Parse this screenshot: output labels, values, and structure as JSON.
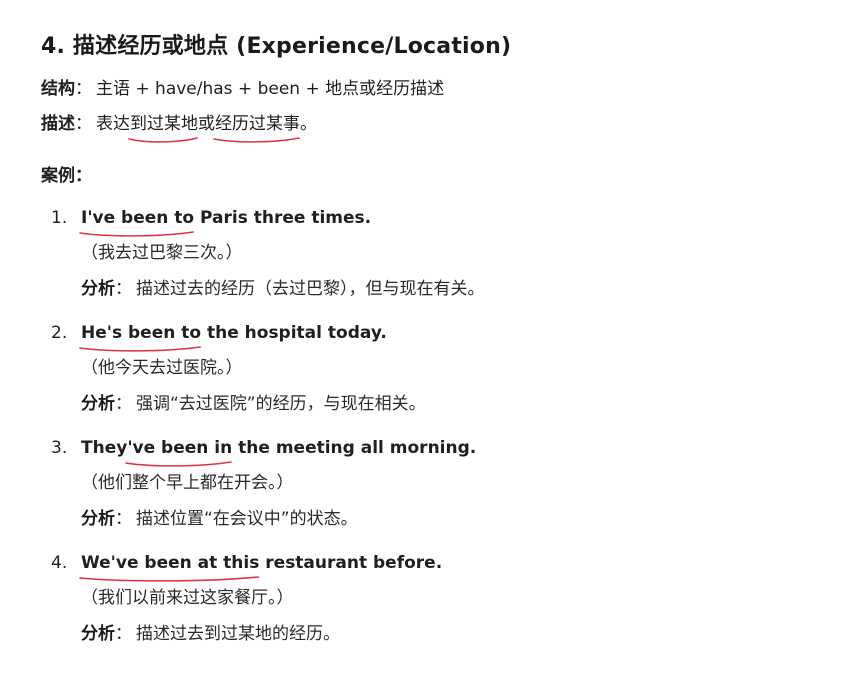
{
  "heading": "4. 描述经历或地点 (Experience/Location)",
  "structure": {
    "label": "结构",
    "colon": "：",
    "text": "主语 + have/has + been + 地点或经历描述"
  },
  "description": {
    "label": "描述",
    "colon": "：",
    "prefix": "表达",
    "part1": "到过某地",
    "middle": "或",
    "part2": "经历过某事",
    "suffix": "。"
  },
  "examples_label": "案例：",
  "analysis_label": "分析",
  "analysis_colon": "：",
  "underline_color": "#d9363e",
  "examples": [
    {
      "num": "1.",
      "en_highlight": "I've been to",
      "en_rest": " Paris three times.",
      "zh": "（我去过巴黎三次。）",
      "analysis": "描述过去的经历（去过巴黎），但与现在有关。"
    },
    {
      "num": "2.",
      "en_highlight": "He's been to",
      "en_rest": " the hospital today.",
      "zh": "（他今天去过医院。）",
      "analysis": "强调“去过医院”的经历，与现在相关。"
    },
    {
      "num": "3.",
      "en_pre": "They",
      "en_highlight": "'ve been in",
      "en_rest": " the meeting all morning.",
      "zh": "（他们整个早上都在开会。）",
      "analysis": "描述位置“在会议中”的状态。"
    },
    {
      "num": "4.",
      "en_highlight": "We've been at this",
      "en_rest": " restaurant before.",
      "zh": "（我们以前来过这家餐厅。）",
      "analysis": "描述过去到过某地的经历。"
    }
  ]
}
